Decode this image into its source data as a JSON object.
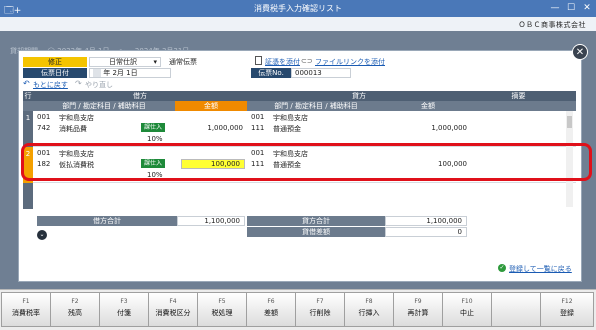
{
  "window": {
    "title": "消費税手入力確認リスト",
    "app_icon": "🗔+",
    "minimize": "—",
    "maximize": "☐",
    "close": "✕"
  },
  "company": "ＯＢＣ商事株式会社",
  "background": {
    "ghost_text": "貸却期間 　◯ 2022年 4月 1日 　～　 2024年 3月31日"
  },
  "header": {
    "mode_label": "修正",
    "journal_type": "日常仕訳",
    "journal_type_arrow": "▾",
    "slip_type": "通常伝票",
    "date_label": "伝票日付",
    "date_value": "年  2月  1日",
    "attach_evidence": "証憑を添付",
    "attach_link": "ファイルリンクを添付",
    "slip_no_label": "伝票No.",
    "slip_no": "000013",
    "undo": "もとに戻す",
    "redo": "やり直し"
  },
  "grid": {
    "row_header": "行",
    "debit_header": "借方",
    "credit_header": "貸方",
    "memo_header": "摘要",
    "sub_header_debit": "部門 / 勘定科目 / 補助科目",
    "amount_header": "金額",
    "sub_header_credit": "部門 / 勘定科目 / 補助科目",
    "amount_header_credit": "金額",
    "rows": [
      {
        "no": "1",
        "debit_dept_code": "001",
        "debit_dept": "宇和島支店",
        "debit_acct_code": "742",
        "debit_acct": "消耗品費",
        "tax_tag": "課仕入",
        "tax_rate": "10%",
        "debit_amount": "1,000,000",
        "credit_dept_code": "001",
        "credit_dept": "宇和島支店",
        "credit_acct_code": "111",
        "credit_acct": "普通預金",
        "credit_amount": "1,000,000"
      },
      {
        "no": "2",
        "debit_dept_code": "001",
        "debit_dept": "宇和島支店",
        "debit_acct_code": "182",
        "debit_acct": "仮払消費税",
        "tax_tag": "課仕入",
        "tax_rate": "10%",
        "debit_amount": "100,000",
        "credit_dept_code": "001",
        "credit_dept": "宇和島支店",
        "credit_acct_code": "111",
        "credit_acct": "普通預金",
        "credit_amount": "100,000"
      }
    ]
  },
  "totals": {
    "debit_total_label": "借方合計",
    "debit_total": "1,100,000",
    "credit_total_label": "貸方合計",
    "credit_total": "1,100,000",
    "diff_label": "貸借差額",
    "diff": "0",
    "expand_icon": "⌄"
  },
  "register_link": "登録して一覧に戻る",
  "fkeys": [
    {
      "key": "F1",
      "label": "消費税率"
    },
    {
      "key": "F2",
      "label": "残高"
    },
    {
      "key": "F3",
      "label": "付箋"
    },
    {
      "key": "F4",
      "label": "消費税区分"
    },
    {
      "key": "F5",
      "label": "税処理"
    },
    {
      "key": "F6",
      "label": "差額"
    },
    {
      "key": "F7",
      "label": "行削除"
    },
    {
      "key": "F8",
      "label": "行挿入"
    },
    {
      "key": "F9",
      "label": "再計算"
    },
    {
      "key": "F10",
      "label": "中止"
    },
    {
      "key": "",
      "label": ""
    },
    {
      "key": "F12",
      "label": "登録"
    }
  ],
  "colors": {
    "accent_orange": "#f08a00",
    "tax_tag_green": "#1e8a3a",
    "highlight_red": "#e0101a",
    "titlebar_blue": "#4a78b8"
  }
}
